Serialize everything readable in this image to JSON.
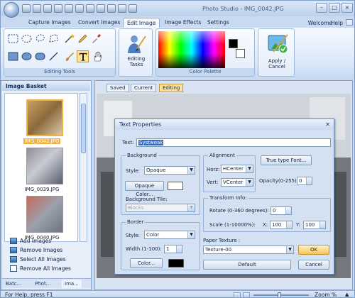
{
  "app": {
    "title": "Photo Studio - IMG_0042.JPG",
    "tabs": [
      "Capture Images",
      "Convert Images",
      "Edit Image",
      "Image Effects",
      "Settings"
    ],
    "active_tab": "Edit Image",
    "welcome": "Welcome",
    "help": "Help",
    "window_buttons": [
      "–",
      "□",
      "×"
    ],
    "status": "For Help, press F1",
    "zoom_label": "Zoom %"
  },
  "ribbon": {
    "editing_tools_label": "Editing Tools",
    "editing_tasks_label": "Editing Tasks",
    "color_palette_label": "Color Palette",
    "apply_cancel_label": "Apply / Cancel",
    "selected_tool": "text-tool",
    "primary_color": "#000000",
    "secondary_color": "#ffffff",
    "icons": [
      "rect-select-icon",
      "ellipse-select-icon",
      "lasso-icon",
      "pencil-icon",
      "dropper-icon",
      "rectangle-icon",
      "ellipse-icon",
      "line-icon",
      "brush-icon",
      "text-icon",
      "pan-hand-icon"
    ]
  },
  "basket": {
    "title": "Image Basket",
    "images": [
      "IMG_0042.JPG",
      "IMG_0039.JPG",
      "IMG_0040.JPG"
    ],
    "selected": "IMG_0042.JPG",
    "actions": [
      "Add Images",
      "Remove Images",
      "Select All Images",
      "Remove All Images"
    ],
    "bottom_tabs": [
      "Batc...",
      "Phot...",
      "Ima..."
    ]
  },
  "editor": {
    "tabs": [
      "Saved",
      "Current",
      "Editing"
    ],
    "active_tab": "Editing"
  },
  "dialog": {
    "title": "Text Properties",
    "text_label": "Text:",
    "text_value": "Systweak",
    "background": {
      "title": "Background",
      "style_label": "Style:",
      "style_value": "Opaque",
      "color_button": "Opaque Color...",
      "tile_label": "Background Tile:",
      "tile_value": "Blocks"
    },
    "alignment": {
      "title": "Alignment",
      "horz_label": "Horz:",
      "horz_value": "HCenter",
      "vert_label": "Vert:",
      "vert_value": "VCenter"
    },
    "font_button": "True type Font...",
    "opacity_label": "Opacity(0-255):",
    "opacity_value": "0",
    "transform": {
      "title": "Transform Info:",
      "rotate_label": "Rotate (0-360 degrees):",
      "rotate_value": "0",
      "scale_label": "Scale (1-10000%):",
      "x_label": "X:",
      "x_value": "100",
      "y_label": "Y:",
      "y_value": "100"
    },
    "border": {
      "title": "Border",
      "style_label": "Style:",
      "style_value": "Color",
      "width_label": "Width (1-100):",
      "width_value": "1",
      "color_button": "Color..."
    },
    "paper_texture_label": "Paper Texture :",
    "paper_texture_value": "Texture-00",
    "ok": "OK",
    "default": "Default",
    "cancel": "Cancel"
  }
}
